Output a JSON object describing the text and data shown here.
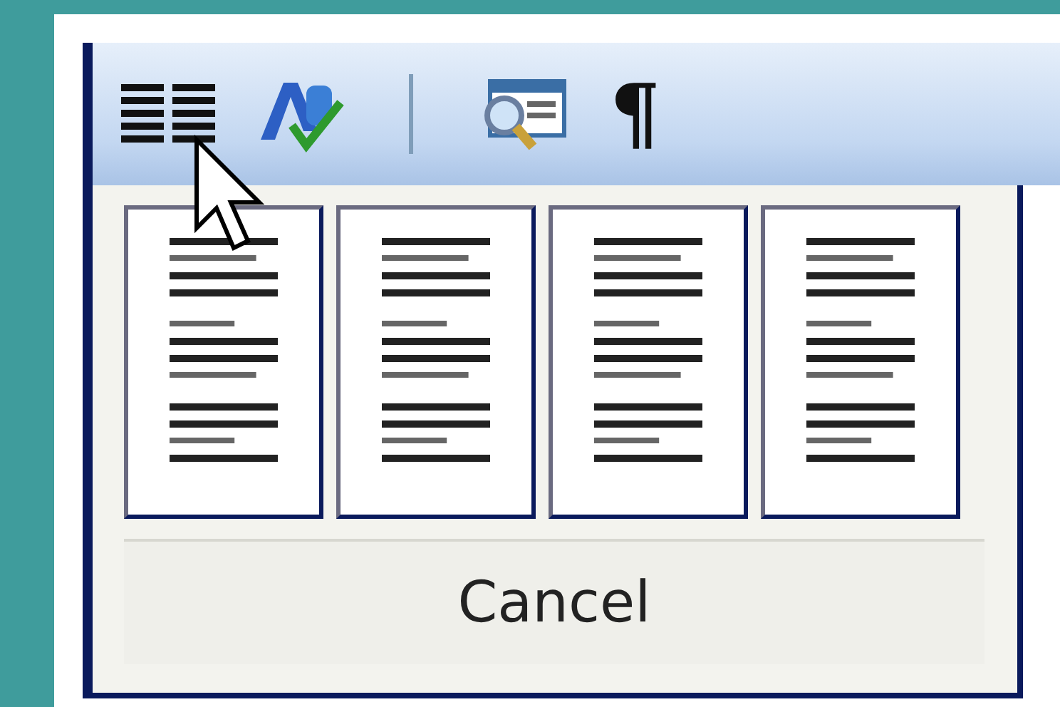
{
  "toolbar": {
    "buttons": [
      {
        "kind": "columns"
      },
      {
        "kind": "spelling"
      },
      {
        "kind": "separator"
      },
      {
        "kind": "research"
      },
      {
        "kind": "pilcrow",
        "label": "¶"
      }
    ]
  },
  "column_previews": [
    {
      "kind": "page"
    },
    {
      "kind": "page"
    },
    {
      "kind": "page"
    },
    {
      "kind": "page"
    }
  ],
  "cancel_button": {
    "label": "Cancel"
  }
}
